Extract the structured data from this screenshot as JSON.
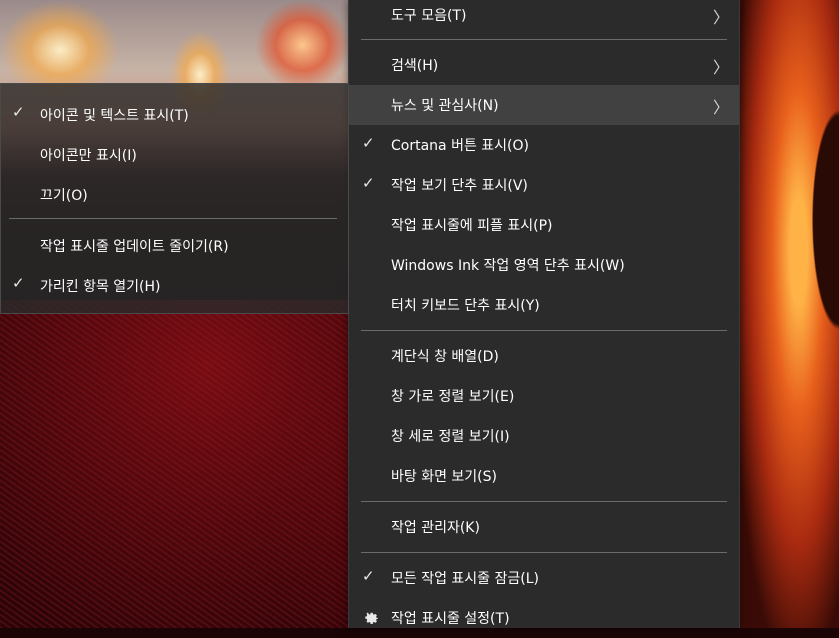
{
  "main_menu": {
    "items": [
      {
        "label": "도구 모음(T)",
        "has_submenu": true,
        "checked": false
      },
      {
        "label": "검색(H)",
        "has_submenu": true,
        "checked": false
      },
      {
        "label": "뉴스 및 관심사(N)",
        "has_submenu": true,
        "checked": false,
        "highlighted": true
      },
      {
        "label": "Cortana 버튼 표시(O)",
        "checked": true
      },
      {
        "label": "작업 보기 단추 표시(V)",
        "checked": true
      },
      {
        "label": "작업 표시줄에 피플 표시(P)",
        "checked": false
      },
      {
        "label": "Windows Ink 작업 영역 단추 표시(W)",
        "checked": false
      },
      {
        "label": "터치 키보드 단추 표시(Y)",
        "checked": false
      },
      {
        "label": "계단식 창 배열(D)"
      },
      {
        "label": "창 가로 정렬 보기(E)"
      },
      {
        "label": "창 세로 정렬 보기(I)"
      },
      {
        "label": "바탕 화면 보기(S)"
      },
      {
        "label": "작업 관리자(K)"
      },
      {
        "label": "모든 작업 표시줄 잠금(L)",
        "checked": true
      },
      {
        "label": "작업 표시줄 설정(T)",
        "icon": "gear-icon"
      }
    ]
  },
  "sub_menu": {
    "items": [
      {
        "label": "아이콘 및 텍스트 표시(T)",
        "checked": true
      },
      {
        "label": "아이콘만 표시(I)",
        "checked": false
      },
      {
        "label": "끄기(O)",
        "checked": false
      },
      {
        "label": "작업 표시줄 업데이트 줄이기(R)",
        "checked": false
      },
      {
        "label": "가리킨 항목 열기(H)",
        "checked": true
      }
    ]
  },
  "glyphs": {
    "check": "✓",
    "chevron": "〉"
  },
  "colors": {
    "menu_bg": "#2b2b2b",
    "hover_bg": "#414141",
    "separator": "#6a6a6a",
    "text": "#ffffff"
  }
}
